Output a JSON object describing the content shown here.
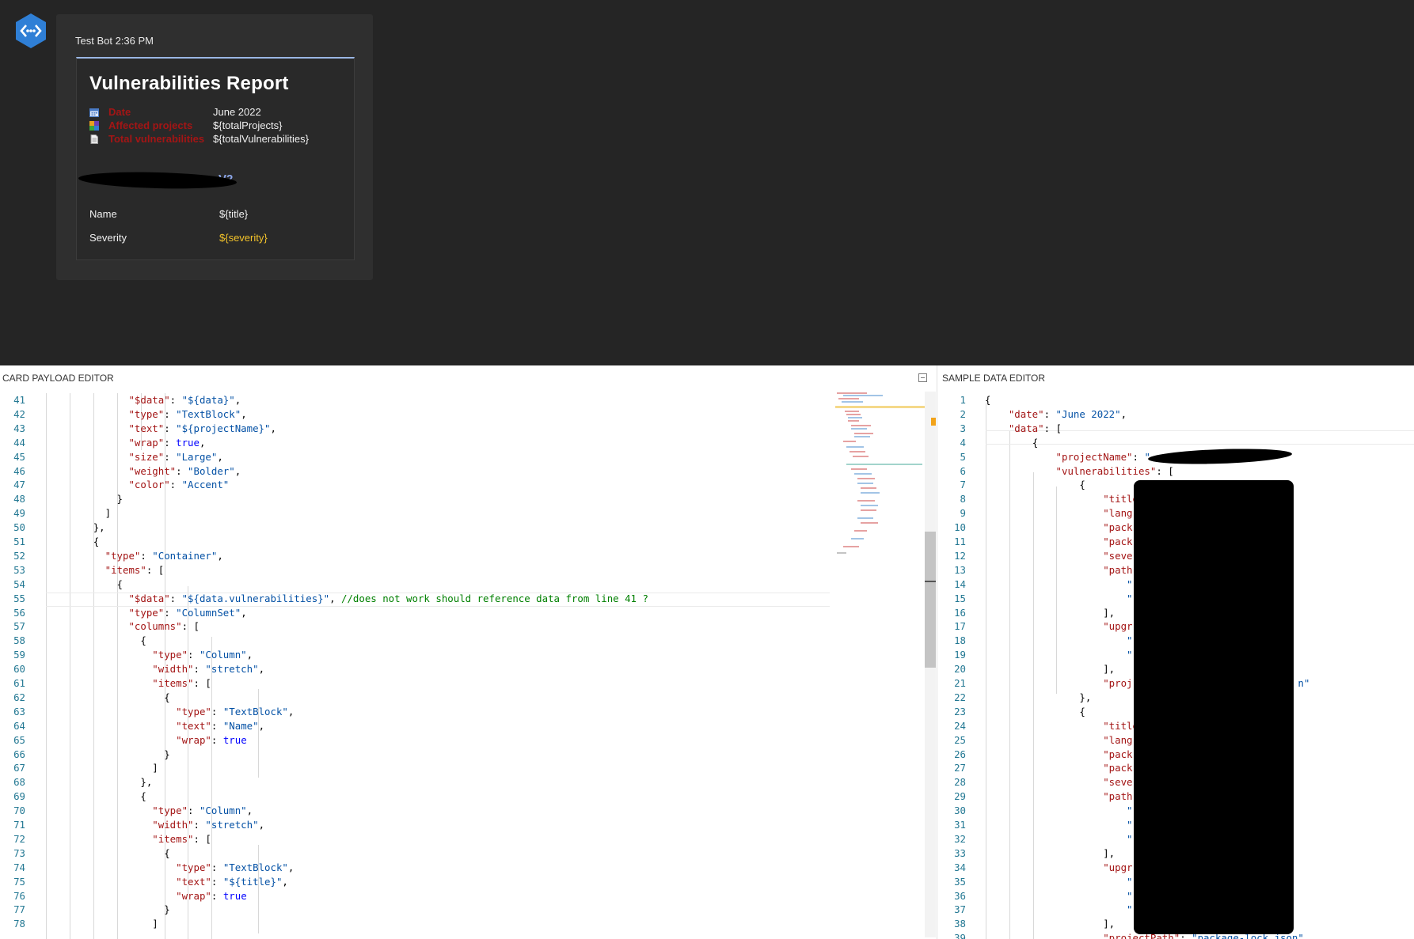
{
  "preview": {
    "author": "Test Bot",
    "time": "2:36 PM",
    "card": {
      "title": "Vulnerabilities Report",
      "facts": [
        {
          "icon": "calendar-icon",
          "label": "Date",
          "value": "June 2022"
        },
        {
          "icon": "puzzle-icon",
          "label": "Affected projects",
          "value": "${totalProjects}"
        },
        {
          "icon": "document-icon",
          "label": "Total vulnerabilities",
          "value": "${totalVulnerabilities}"
        }
      ],
      "project_name_visible": "V2",
      "rows": [
        {
          "label": "Name",
          "value": "${title}"
        },
        {
          "label": "Severity",
          "value": "${severity}"
        }
      ],
      "severity_color": "#f2c22a",
      "accent_color": "#8ca6e8"
    }
  },
  "editors": {
    "left_title": "CARD PAYLOAD EDITOR",
    "right_title": "SAMPLE DATA EDITOR",
    "left_lines": [
      {
        "n": "41",
        "i": 14,
        "t": [
          [
            "k",
            "\"$data\""
          ],
          [
            "p",
            ": "
          ],
          [
            "s",
            "\"${data}\""
          ],
          [
            "p",
            ","
          ]
        ]
      },
      {
        "n": "42",
        "i": 14,
        "t": [
          [
            "k",
            "\"type\""
          ],
          [
            "p",
            ": "
          ],
          [
            "s",
            "\"TextBlock\""
          ],
          [
            "p",
            ","
          ]
        ]
      },
      {
        "n": "43",
        "i": 14,
        "t": [
          [
            "k",
            "\"text\""
          ],
          [
            "p",
            ": "
          ],
          [
            "s",
            "\"${projectName}\""
          ],
          [
            "p",
            ","
          ]
        ]
      },
      {
        "n": "44",
        "i": 14,
        "t": [
          [
            "k",
            "\"wrap\""
          ],
          [
            "p",
            ": "
          ],
          [
            "b",
            "true"
          ],
          [
            "p",
            ","
          ]
        ]
      },
      {
        "n": "45",
        "i": 14,
        "t": [
          [
            "k",
            "\"size\""
          ],
          [
            "p",
            ": "
          ],
          [
            "s",
            "\"Large\""
          ],
          [
            "p",
            ","
          ]
        ]
      },
      {
        "n": "46",
        "i": 14,
        "t": [
          [
            "k",
            "\"weight\""
          ],
          [
            "p",
            ": "
          ],
          [
            "s",
            "\"Bolder\""
          ],
          [
            "p",
            ","
          ]
        ]
      },
      {
        "n": "47",
        "i": 14,
        "t": [
          [
            "k",
            "\"color\""
          ],
          [
            "p",
            ": "
          ],
          [
            "s",
            "\"Accent\""
          ]
        ]
      },
      {
        "n": "48",
        "i": 12,
        "t": [
          [
            "p",
            "}"
          ]
        ]
      },
      {
        "n": "49",
        "i": 10,
        "t": [
          [
            "p",
            "]"
          ]
        ]
      },
      {
        "n": "50",
        "i": 8,
        "t": [
          [
            "p",
            "},"
          ]
        ]
      },
      {
        "n": "51",
        "i": 8,
        "t": [
          [
            "p",
            "{"
          ]
        ]
      },
      {
        "n": "52",
        "i": 10,
        "t": [
          [
            "k",
            "\"type\""
          ],
          [
            "p",
            ": "
          ],
          [
            "s",
            "\"Container\""
          ],
          [
            "p",
            ","
          ]
        ]
      },
      {
        "n": "53",
        "i": 10,
        "t": [
          [
            "k",
            "\"items\""
          ],
          [
            "p",
            ": ["
          ]
        ]
      },
      {
        "n": "54",
        "i": 12,
        "t": [
          [
            "p",
            "{"
          ]
        ]
      },
      {
        "n": "55",
        "i": 14,
        "t": [
          [
            "k",
            "\"$data\""
          ],
          [
            "p",
            ": "
          ],
          [
            "s",
            "\"${data.vulnerabilities}\""
          ],
          [
            "p",
            ", "
          ],
          [
            "c",
            "//does not work should reference data from line 41 ?"
          ]
        ]
      },
      {
        "n": "56",
        "i": 14,
        "t": [
          [
            "k",
            "\"type\""
          ],
          [
            "p",
            ": "
          ],
          [
            "s",
            "\"ColumnSet\""
          ],
          [
            "p",
            ","
          ]
        ]
      },
      {
        "n": "57",
        "i": 14,
        "t": [
          [
            "k",
            "\"columns\""
          ],
          [
            "p",
            ": ["
          ]
        ]
      },
      {
        "n": "58",
        "i": 16,
        "t": [
          [
            "p",
            "{"
          ]
        ]
      },
      {
        "n": "59",
        "i": 18,
        "t": [
          [
            "k",
            "\"type\""
          ],
          [
            "p",
            ": "
          ],
          [
            "s",
            "\"Column\""
          ],
          [
            "p",
            ","
          ]
        ]
      },
      {
        "n": "60",
        "i": 18,
        "t": [
          [
            "k",
            "\"width\""
          ],
          [
            "p",
            ": "
          ],
          [
            "s",
            "\"stretch\""
          ],
          [
            "p",
            ","
          ]
        ]
      },
      {
        "n": "61",
        "i": 18,
        "t": [
          [
            "k",
            "\"items\""
          ],
          [
            "p",
            ": ["
          ]
        ]
      },
      {
        "n": "62",
        "i": 20,
        "t": [
          [
            "p",
            "{"
          ]
        ]
      },
      {
        "n": "63",
        "i": 22,
        "t": [
          [
            "k",
            "\"type\""
          ],
          [
            "p",
            ": "
          ],
          [
            "s",
            "\"TextBlock\""
          ],
          [
            "p",
            ","
          ]
        ]
      },
      {
        "n": "64",
        "i": 22,
        "t": [
          [
            "k",
            "\"text\""
          ],
          [
            "p",
            ": "
          ],
          [
            "s",
            "\"Name\""
          ],
          [
            "p",
            ","
          ]
        ]
      },
      {
        "n": "65",
        "i": 22,
        "t": [
          [
            "k",
            "\"wrap\""
          ],
          [
            "p",
            ": "
          ],
          [
            "b",
            "true"
          ]
        ]
      },
      {
        "n": "66",
        "i": 20,
        "t": [
          [
            "p",
            "}"
          ]
        ]
      },
      {
        "n": "67",
        "i": 18,
        "t": [
          [
            "p",
            "]"
          ]
        ]
      },
      {
        "n": "68",
        "i": 16,
        "t": [
          [
            "p",
            "},"
          ]
        ]
      },
      {
        "n": "69",
        "i": 16,
        "t": [
          [
            "p",
            "{"
          ]
        ]
      },
      {
        "n": "70",
        "i": 18,
        "t": [
          [
            "k",
            "\"type\""
          ],
          [
            "p",
            ": "
          ],
          [
            "s",
            "\"Column\""
          ],
          [
            "p",
            ","
          ]
        ]
      },
      {
        "n": "71",
        "i": 18,
        "t": [
          [
            "k",
            "\"width\""
          ],
          [
            "p",
            ": "
          ],
          [
            "s",
            "\"stretch\""
          ],
          [
            "p",
            ","
          ]
        ]
      },
      {
        "n": "72",
        "i": 18,
        "t": [
          [
            "k",
            "\"items\""
          ],
          [
            "p",
            ": ["
          ]
        ]
      },
      {
        "n": "73",
        "i": 20,
        "t": [
          [
            "p",
            "{"
          ]
        ]
      },
      {
        "n": "74",
        "i": 22,
        "t": [
          [
            "k",
            "\"type\""
          ],
          [
            "p",
            ": "
          ],
          [
            "s",
            "\"TextBlock\""
          ],
          [
            "p",
            ","
          ]
        ]
      },
      {
        "n": "75",
        "i": 22,
        "t": [
          [
            "k",
            "\"text\""
          ],
          [
            "p",
            ": "
          ],
          [
            "s",
            "\"${title}\""
          ],
          [
            "p",
            ","
          ]
        ]
      },
      {
        "n": "76",
        "i": 22,
        "t": [
          [
            "k",
            "\"wrap\""
          ],
          [
            "p",
            ": "
          ],
          [
            "b",
            "true"
          ]
        ]
      },
      {
        "n": "77",
        "i": 20,
        "t": [
          [
            "p",
            "}"
          ]
        ]
      },
      {
        "n": "78",
        "i": 18,
        "t": [
          [
            "p",
            "]"
          ]
        ]
      }
    ],
    "right_lines": [
      {
        "n": "1",
        "i": 0,
        "t": [
          [
            "p",
            "{"
          ]
        ]
      },
      {
        "n": "2",
        "i": 4,
        "t": [
          [
            "k",
            "\"date\""
          ],
          [
            "p",
            ": "
          ],
          [
            "s",
            "\"June 2022\""
          ],
          [
            "p",
            ","
          ]
        ]
      },
      {
        "n": "3",
        "i": 4,
        "t": [
          [
            "k",
            "\"data\""
          ],
          [
            "p",
            ": ["
          ]
        ]
      },
      {
        "n": "4",
        "i": 8,
        "t": [
          [
            "p",
            "{"
          ]
        ]
      },
      {
        "n": "5",
        "i": 12,
        "t": [
          [
            "k",
            "\"projectName\""
          ],
          [
            "p",
            ": "
          ],
          [
            "s",
            "\""
          ]
        ]
      },
      {
        "n": "6",
        "i": 12,
        "t": [
          [
            "k",
            "\"vulnerabilities\""
          ],
          [
            "p",
            ": ["
          ]
        ]
      },
      {
        "n": "7",
        "i": 16,
        "t": [
          [
            "p",
            "{"
          ]
        ]
      },
      {
        "n": "8",
        "i": 20,
        "t": [
          [
            "k",
            "\"title"
          ]
        ]
      },
      {
        "n": "9",
        "i": 20,
        "t": [
          [
            "k",
            "\"lang"
          ]
        ]
      },
      {
        "n": "10",
        "i": 20,
        "t": [
          [
            "k",
            "\"pack"
          ]
        ]
      },
      {
        "n": "11",
        "i": 20,
        "t": [
          [
            "k",
            "\"pack"
          ]
        ]
      },
      {
        "n": "12",
        "i": 20,
        "t": [
          [
            "k",
            "\"seve"
          ]
        ]
      },
      {
        "n": "13",
        "i": 20,
        "t": [
          [
            "k",
            "\"path"
          ]
        ]
      },
      {
        "n": "14",
        "i": 24,
        "t": [
          [
            "s",
            "\""
          ]
        ]
      },
      {
        "n": "15",
        "i": 24,
        "t": [
          [
            "s",
            "\""
          ]
        ]
      },
      {
        "n": "16",
        "i": 20,
        "t": [
          [
            "p",
            "],"
          ]
        ]
      },
      {
        "n": "17",
        "i": 20,
        "t": [
          [
            "k",
            "\"upgr"
          ]
        ]
      },
      {
        "n": "18",
        "i": 24,
        "t": [
          [
            "s",
            "\""
          ]
        ]
      },
      {
        "n": "19",
        "i": 24,
        "t": [
          [
            "s",
            "\""
          ]
        ]
      },
      {
        "n": "20",
        "i": 20,
        "t": [
          [
            "p",
            "],"
          ]
        ]
      },
      {
        "n": "21",
        "i": 20,
        "t": [
          [
            "k",
            "\"proj"
          ],
          [
            "p",
            "                            "
          ],
          [
            "s",
            "n\""
          ]
        ]
      },
      {
        "n": "22",
        "i": 16,
        "t": [
          [
            "p",
            "},"
          ]
        ]
      },
      {
        "n": "23",
        "i": 16,
        "t": [
          [
            "p",
            "{"
          ]
        ]
      },
      {
        "n": "24",
        "i": 20,
        "t": [
          [
            "k",
            "\"title"
          ]
        ]
      },
      {
        "n": "25",
        "i": 20,
        "t": [
          [
            "k",
            "\"lang"
          ]
        ]
      },
      {
        "n": "26",
        "i": 20,
        "t": [
          [
            "k",
            "\"pack"
          ]
        ]
      },
      {
        "n": "27",
        "i": 20,
        "t": [
          [
            "k",
            "\"pack"
          ]
        ]
      },
      {
        "n": "28",
        "i": 20,
        "t": [
          [
            "k",
            "\"seve"
          ]
        ]
      },
      {
        "n": "29",
        "i": 20,
        "t": [
          [
            "k",
            "\"path"
          ]
        ]
      },
      {
        "n": "30",
        "i": 24,
        "t": [
          [
            "s",
            "\""
          ]
        ]
      },
      {
        "n": "31",
        "i": 24,
        "t": [
          [
            "s",
            "\""
          ]
        ]
      },
      {
        "n": "32",
        "i": 24,
        "t": [
          [
            "s",
            "\""
          ]
        ]
      },
      {
        "n": "33",
        "i": 20,
        "t": [
          [
            "p",
            "],"
          ]
        ]
      },
      {
        "n": "34",
        "i": 20,
        "t": [
          [
            "k",
            "\"upgr"
          ]
        ]
      },
      {
        "n": "35",
        "i": 24,
        "t": [
          [
            "s",
            "\""
          ]
        ]
      },
      {
        "n": "36",
        "i": 24,
        "t": [
          [
            "s",
            "\""
          ]
        ]
      },
      {
        "n": "37",
        "i": 24,
        "t": [
          [
            "s",
            "\""
          ]
        ]
      },
      {
        "n": "38",
        "i": 20,
        "t": [
          [
            "p",
            "],"
          ]
        ]
      },
      {
        "n": "39",
        "i": 20,
        "t": [
          [
            "k",
            "\"projectPath\""
          ],
          [
            "p",
            ": "
          ],
          [
            "s",
            "\"package-lock.json\""
          ]
        ]
      }
    ]
  }
}
